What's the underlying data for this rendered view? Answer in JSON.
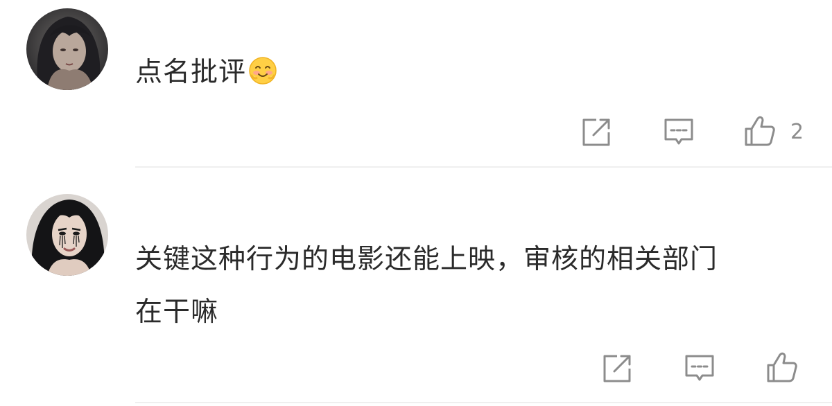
{
  "comments": [
    {
      "text": "点名批评",
      "emoji": "shy-smile-emoji",
      "like_count": "2"
    },
    {
      "text_line1": "关键这种行为的电影还能上映，审核的相关部门",
      "text_line2": "在干嘛"
    }
  ],
  "icons": {
    "share": "share-icon",
    "reply": "comment-icon",
    "like": "thumbs-up-icon"
  },
  "colors": {
    "text": "#2a2a2a",
    "icon": "#8c8c8c",
    "divider": "#efefef",
    "emoji": "#ffcf45"
  }
}
